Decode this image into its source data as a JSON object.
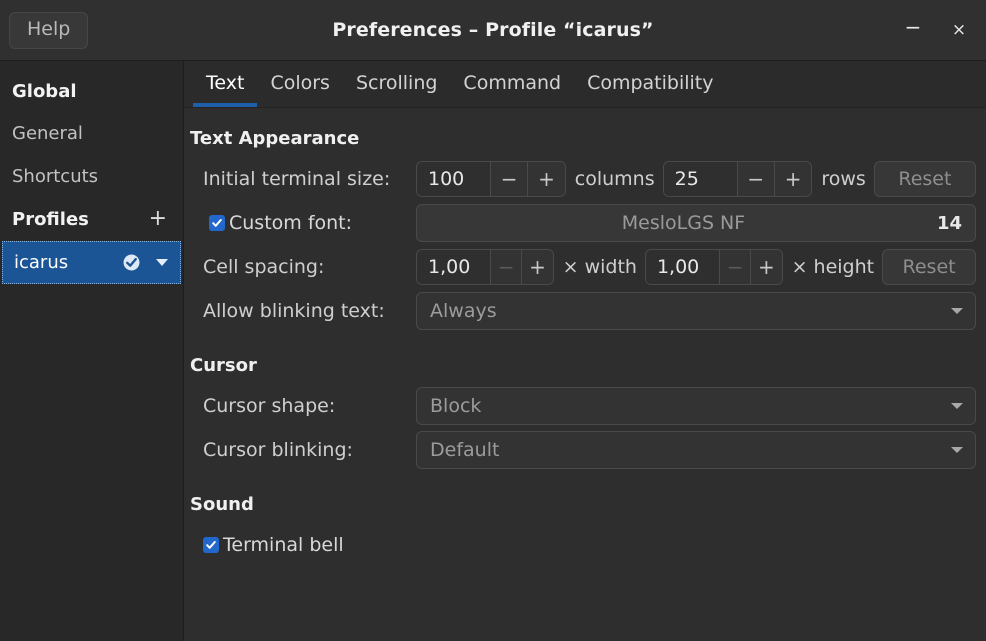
{
  "window": {
    "title": "Preferences – Profile “icarus”",
    "help_label": "Help",
    "minimize_icon": "−",
    "close_icon": "×"
  },
  "sidebar": {
    "global_heading": "Global",
    "items": [
      {
        "label": "General"
      },
      {
        "label": "Shortcuts"
      }
    ],
    "profiles_heading": "Profiles",
    "add_profile_icon": "+",
    "profiles": [
      {
        "name": "icarus",
        "default_marked": true,
        "selected": true
      }
    ]
  },
  "tabs": [
    {
      "label": "Text",
      "active": true
    },
    {
      "label": "Colors",
      "active": false
    },
    {
      "label": "Scrolling",
      "active": false
    },
    {
      "label": "Command",
      "active": false
    },
    {
      "label": "Compatibility",
      "active": false
    }
  ],
  "text_appearance": {
    "heading": "Text Appearance",
    "initial_size": {
      "label": "Initial terminal size:",
      "columns_value": "100",
      "columns_unit": "columns",
      "rows_value": "25",
      "rows_unit": "rows",
      "minus_icon": "−",
      "plus_icon": "+",
      "reset_label": "Reset"
    },
    "custom_font": {
      "label": "Custom font:",
      "checked": true,
      "font_name": "MesloLGS NF",
      "font_size": "14"
    },
    "cell_spacing": {
      "label": "Cell spacing:",
      "width_value": "1,00",
      "width_unit": "× width",
      "height_value": "1,00",
      "height_unit": "× height",
      "minus_icon": "−",
      "plus_icon": "+",
      "reset_label": "Reset"
    },
    "blinking_text": {
      "label": "Allow blinking text:",
      "value": "Always"
    }
  },
  "cursor": {
    "heading": "Cursor",
    "shape": {
      "label": "Cursor shape:",
      "value": "Block"
    },
    "blinking": {
      "label": "Cursor blinking:",
      "value": "Default"
    }
  },
  "sound": {
    "heading": "Sound",
    "terminal_bell": {
      "label": "Terminal bell",
      "checked": true
    }
  },
  "colors": {
    "accent_blue": "#1f5fa9",
    "selection_blue": "#1c5596",
    "checkbox_blue": "#2268cc",
    "window_bg": "#2e2e2e",
    "sidebar_bg": "#282828",
    "titlebar_bg": "#303030"
  }
}
